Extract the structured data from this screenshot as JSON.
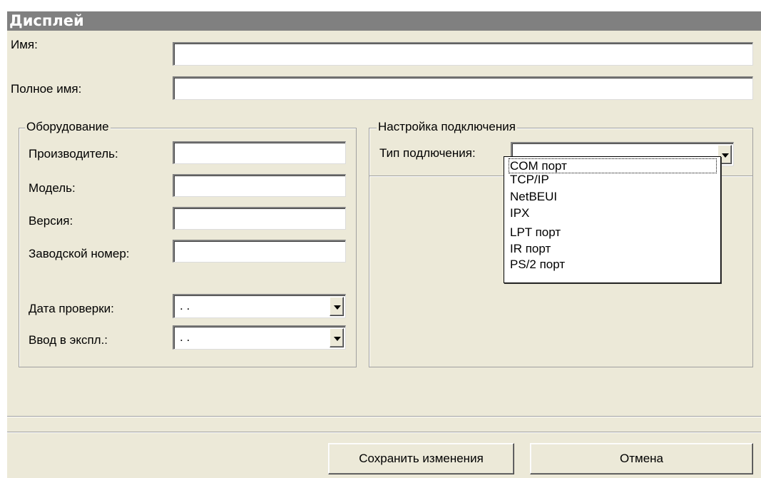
{
  "window": {
    "title": "Дисплей"
  },
  "form": {
    "name_label": "Имя:",
    "name_value": "",
    "fullname_label": "Полное имя:",
    "fullname_value": ""
  },
  "equipment": {
    "group_title": "Оборудование",
    "manufacturer_label": "Производитель:",
    "manufacturer_value": "",
    "model_label": "Модель:",
    "model_value": "",
    "version_label": "Версия:",
    "version_value": "",
    "serial_label": "Заводской номер:",
    "serial_value": "",
    "check_date_label": "Дата проверки:",
    "check_date_value": ". .",
    "commission_label": "Ввод в экспл.:",
    "commission_value": ". ."
  },
  "connection": {
    "group_title": "Настройка подключения",
    "type_label": "Тип подлючения:",
    "type_value": "",
    "options": [
      "COM порт",
      "TCP/IP",
      "NetBEUI",
      "IPX",
      "LPT порт",
      "IR порт",
      "PS/2 порт"
    ]
  },
  "buttons": {
    "save": "Сохранить изменения",
    "cancel": "Отмена"
  }
}
